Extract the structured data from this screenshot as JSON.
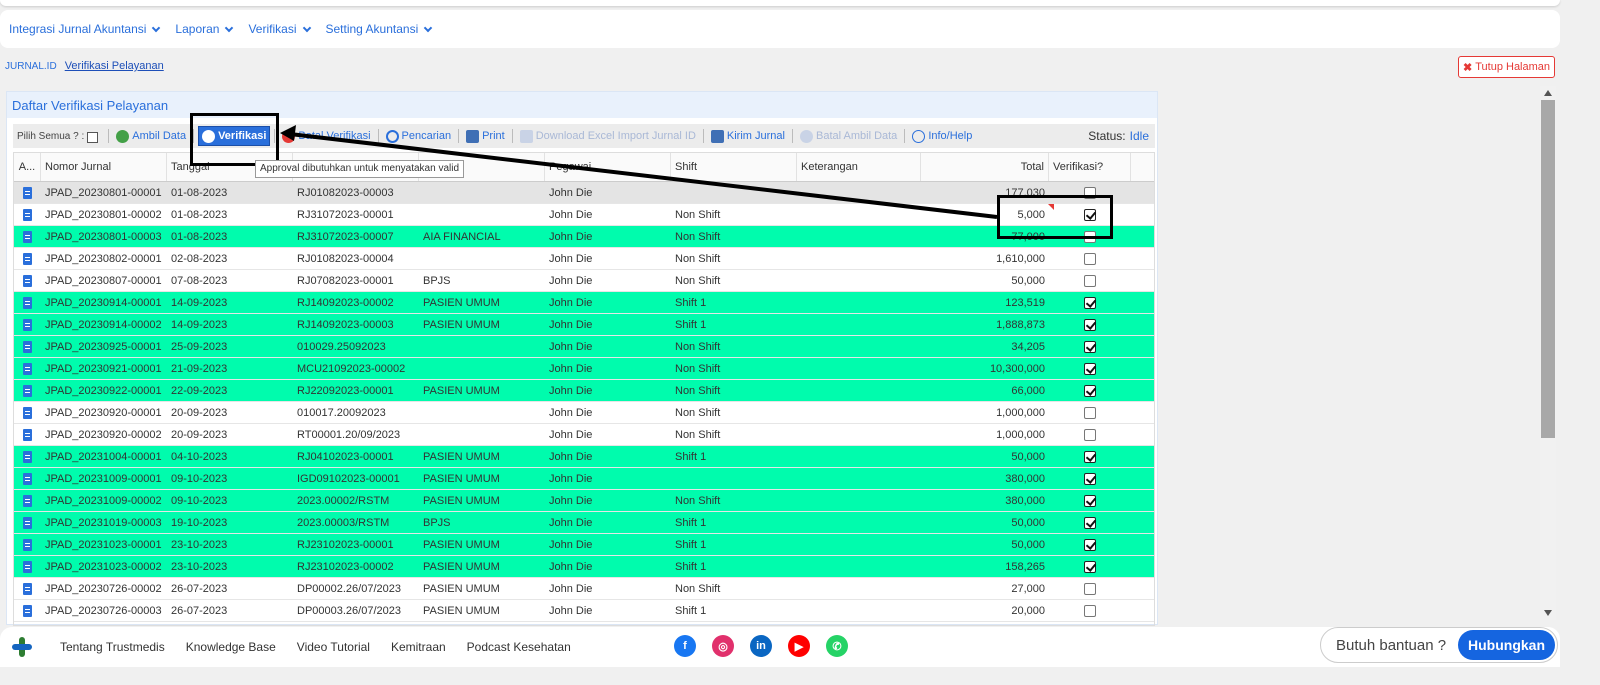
{
  "menu": [
    {
      "label": "Integrasi Jurnal Akuntansi"
    },
    {
      "label": "Laporan"
    },
    {
      "label": "Verifikasi"
    },
    {
      "label": "Setting Akuntansi"
    }
  ],
  "breadcrumb": {
    "root": "JURNAL.ID",
    "tab": "Verifikasi Pelayanan"
  },
  "close_page": "Tutup Halaman",
  "panel": {
    "title": "Daftar Verifikasi Pelayanan"
  },
  "toolbar": {
    "select_all": "Pilih Semua ? :",
    "buttons": [
      {
        "label": "Ambil Data",
        "icon": "globe-icon",
        "state": "enabled"
      },
      {
        "label": "Verifikasi",
        "icon": "upload-icon",
        "state": "active"
      },
      {
        "label": "Batal Verifikasi",
        "icon": "cancel-icon",
        "state": "enabled"
      },
      {
        "label": "Pencarian",
        "icon": "search-icon",
        "state": "enabled"
      },
      {
        "label": "Print",
        "icon": "printer-icon",
        "state": "enabled"
      },
      {
        "label": "Download Excel Import Jurnal ID",
        "icon": "printer-icon",
        "state": "disabled"
      },
      {
        "label": "Kirim Jurnal",
        "icon": "printer-icon",
        "state": "enabled"
      },
      {
        "label": "Batal Ambil Data",
        "icon": "cancel-icon",
        "state": "disabled"
      },
      {
        "label": "Info/Help",
        "icon": "info-icon",
        "state": "enabled"
      }
    ],
    "status_label": "Status:",
    "status_value": "Idle"
  },
  "tooltip": "Approval dibutuhkan untuk menyatakan valid",
  "grid": {
    "columns": [
      "A...",
      "Nomor Jurnal",
      "Tanggal",
      "",
      "",
      "Pegawai",
      "Shift",
      "Keterangan",
      "Total",
      "Verifikasi?"
    ],
    "rows": [
      {
        "nomor": "JPAD_20230801-00001",
        "tanggal": "01-08-2023",
        "ref": "RJ01082023-00003",
        "penjamin": "",
        "pegawai": "John Die",
        "shift": "",
        "ket": "",
        "total": "177,030",
        "verified": false,
        "style": "sel"
      },
      {
        "nomor": "JPAD_20230801-00002",
        "tanggal": "01-08-2023",
        "ref": "RJ31072023-00001",
        "penjamin": "",
        "pegawai": "John Die",
        "shift": "Non Shift",
        "ket": "",
        "total": "5,000",
        "verified": true,
        "style": "white"
      },
      {
        "nomor": "JPAD_20230801-00003",
        "tanggal": "01-08-2023",
        "ref": "RJ31072023-00007",
        "penjamin": "AIA FINANCIAL",
        "pegawai": "John Die",
        "shift": "Non Shift",
        "ket": "",
        "total": "77,000",
        "verified": false,
        "style": "green"
      },
      {
        "nomor": "JPAD_20230802-00001",
        "tanggal": "02-08-2023",
        "ref": "RJ01082023-00004",
        "penjamin": "",
        "pegawai": "John Die",
        "shift": "Non Shift",
        "ket": "",
        "total": "1,610,000",
        "verified": false,
        "style": "white"
      },
      {
        "nomor": "JPAD_20230807-00001",
        "tanggal": "07-08-2023",
        "ref": "RJ07082023-00001",
        "penjamin": "BPJS",
        "pegawai": "John Die",
        "shift": "Non Shift",
        "ket": "",
        "total": "50,000",
        "verified": false,
        "style": "white"
      },
      {
        "nomor": "JPAD_20230914-00001",
        "tanggal": "14-09-2023",
        "ref": "RJ14092023-00002",
        "penjamin": "PASIEN UMUM",
        "pegawai": "John Die",
        "shift": "Shift 1",
        "ket": "",
        "total": "123,519",
        "verified": true,
        "style": "green"
      },
      {
        "nomor": "JPAD_20230914-00002",
        "tanggal": "14-09-2023",
        "ref": "RJ14092023-00003",
        "penjamin": "PASIEN UMUM",
        "pegawai": "John Die",
        "shift": "Shift 1",
        "ket": "",
        "total": "1,888,873",
        "verified": true,
        "style": "green"
      },
      {
        "nomor": "JPAD_20230925-00001",
        "tanggal": "25-09-2023",
        "ref": "010029.25092023",
        "penjamin": "",
        "pegawai": "John Die",
        "shift": "Non Shift",
        "ket": "",
        "total": "34,205",
        "verified": true,
        "style": "green"
      },
      {
        "nomor": "JPAD_20230921-00001",
        "tanggal": "21-09-2023",
        "ref": "MCU21092023-00002",
        "penjamin": "",
        "pegawai": "John Die",
        "shift": "Non Shift",
        "ket": "",
        "total": "10,300,000",
        "verified": true,
        "style": "green"
      },
      {
        "nomor": "JPAD_20230922-00001",
        "tanggal": "22-09-2023",
        "ref": "RJ22092023-00001",
        "penjamin": "PASIEN UMUM",
        "pegawai": "John Die",
        "shift": "Non Shift",
        "ket": "",
        "total": "66,000",
        "verified": true,
        "style": "green"
      },
      {
        "nomor": "JPAD_20230920-00001",
        "tanggal": "20-09-2023",
        "ref": "010017.20092023",
        "penjamin": "",
        "pegawai": "John Die",
        "shift": "Non Shift",
        "ket": "",
        "total": "1,000,000",
        "verified": false,
        "style": "white"
      },
      {
        "nomor": "JPAD_20230920-00002",
        "tanggal": "20-09-2023",
        "ref": "RT00001.20/09/2023",
        "penjamin": "",
        "pegawai": "John Die",
        "shift": "Non Shift",
        "ket": "",
        "total": "1,000,000",
        "verified": false,
        "style": "white"
      },
      {
        "nomor": "JPAD_20231004-00001",
        "tanggal": "04-10-2023",
        "ref": "RJ04102023-00001",
        "penjamin": "PASIEN UMUM",
        "pegawai": "John Die",
        "shift": "Shift 1",
        "ket": "",
        "total": "50,000",
        "verified": true,
        "style": "green"
      },
      {
        "nomor": "JPAD_20231009-00001",
        "tanggal": "09-10-2023",
        "ref": "IGD09102023-00001",
        "penjamin": "PASIEN UMUM",
        "pegawai": "John Die",
        "shift": "",
        "ket": "",
        "total": "380,000",
        "verified": true,
        "style": "green"
      },
      {
        "nomor": "JPAD_20231009-00002",
        "tanggal": "09-10-2023",
        "ref": "2023.00002/RSTM",
        "penjamin": "PASIEN UMUM",
        "pegawai": "John Die",
        "shift": "Non Shift",
        "ket": "",
        "total": "380,000",
        "verified": true,
        "style": "green"
      },
      {
        "nomor": "JPAD_20231019-00003",
        "tanggal": "19-10-2023",
        "ref": "2023.00003/RSTM",
        "penjamin": "BPJS",
        "pegawai": "John Die",
        "shift": "Shift 1",
        "ket": "",
        "total": "50,000",
        "verified": true,
        "style": "green"
      },
      {
        "nomor": "JPAD_20231023-00001",
        "tanggal": "23-10-2023",
        "ref": "RJ23102023-00001",
        "penjamin": "PASIEN UMUM",
        "pegawai": "John Die",
        "shift": "Shift 1",
        "ket": "",
        "total": "50,000",
        "verified": true,
        "style": "green"
      },
      {
        "nomor": "JPAD_20231023-00002",
        "tanggal": "23-10-2023",
        "ref": "RJ23102023-00002",
        "penjamin": "PASIEN UMUM",
        "pegawai": "John Die",
        "shift": "Shift 1",
        "ket": "",
        "total": "158,265",
        "verified": true,
        "style": "green"
      },
      {
        "nomor": "JPAD_20230726-00002",
        "tanggal": "26-07-2023",
        "ref": "DP00002.26/07/2023",
        "penjamin": "PASIEN UMUM",
        "pegawai": "John Die",
        "shift": "Non Shift",
        "ket": "",
        "total": "27,000",
        "verified": false,
        "style": "white"
      },
      {
        "nomor": "JPAD_20230726-00003",
        "tanggal": "26-07-2023",
        "ref": "DP00003.26/07/2023",
        "penjamin": "PASIEN UMUM",
        "pegawai": "John Die",
        "shift": "Shift 1",
        "ket": "",
        "total": "20,000",
        "verified": false,
        "style": "white"
      }
    ]
  },
  "footer": {
    "links": [
      "Tentang Trustmedis",
      "Knowledge Base",
      "Video Tutorial",
      "Kemitraan",
      "Podcast Kesehatan"
    ],
    "social": [
      {
        "icon": "facebook-icon",
        "glyph": "f",
        "color": "#1877f2"
      },
      {
        "icon": "instagram-icon",
        "glyph": "◎",
        "color": "#e1306c"
      },
      {
        "icon": "linkedin-icon",
        "glyph": "in",
        "color": "#0a66c2"
      },
      {
        "icon": "youtube-icon",
        "glyph": "▶",
        "color": "#ff0000"
      },
      {
        "icon": "whatsapp-icon",
        "glyph": "✆",
        "color": "#25d366"
      }
    ],
    "help_text": "Butuh bantuan ?",
    "help_button": "Hubungkan"
  }
}
